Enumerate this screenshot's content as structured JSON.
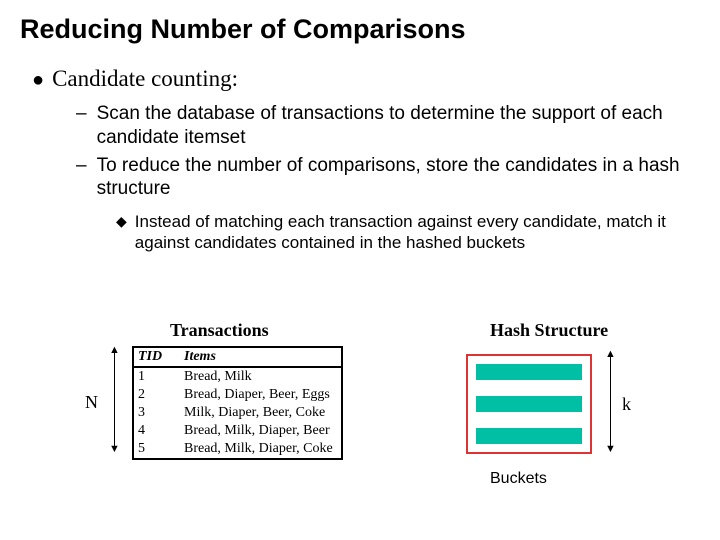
{
  "title": "Reducing Number of Comparisons",
  "bullet1": "Candidate counting:",
  "sub1": "Scan the database of transactions to determine the support of each candidate itemset",
  "sub2": "To reduce the number of comparisons, store the candidates in a hash structure",
  "sub3": "Instead of matching each transaction against every candidate, match it against candidates contained in the hashed buckets",
  "fig": {
    "transactions_label": "Transactions",
    "hash_label": "Hash Structure",
    "n_label": "N",
    "k_label": "k",
    "buckets_label": "Buckets",
    "table": {
      "headers": {
        "tid": "TID",
        "items": "Items"
      },
      "rows": [
        {
          "tid": "1",
          "items": "Bread, Milk"
        },
        {
          "tid": "2",
          "items": "Bread, Diaper, Beer, Eggs"
        },
        {
          "tid": "3",
          "items": "Milk, Diaper, Beer, Coke"
        },
        {
          "tid": "4",
          "items": "Bread, Milk, Diaper, Beer"
        },
        {
          "tid": "5",
          "items": "Bread, Milk, Diaper, Coke"
        }
      ]
    }
  }
}
